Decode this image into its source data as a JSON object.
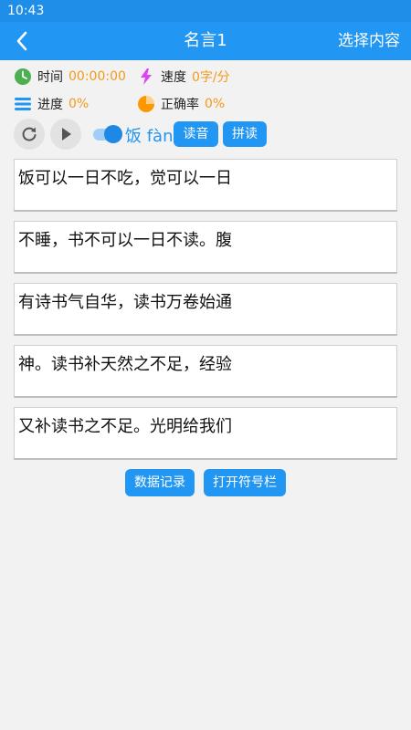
{
  "status_bar": {
    "time": "10:43"
  },
  "app_bar": {
    "title": "名言1",
    "action_label": "选择内容",
    "back_icon": "chevron-left-icon"
  },
  "stats": {
    "time_label": "时间",
    "time_value": "00:00:00",
    "speed_label": "速度",
    "speed_value": "0字/分",
    "progress_label": "进度",
    "progress_value": "0%",
    "accuracy_label": "正确率",
    "accuracy_value": "0%"
  },
  "controls": {
    "pinyin_toggle_on": true,
    "pinyin_label": "饭 fàn",
    "read_label": "读音",
    "spell_label": "拼读"
  },
  "text_lines": [
    "饭可以一日不吃，觉可以一日",
    "不睡，书不可以一日不读。腹",
    "有诗书气自华，读书万卷始通",
    "神。读书补天然之不足，经验",
    "又补读书之不足。光明给我们"
  ],
  "bottom_buttons": {
    "records_label": "数据记录",
    "symbols_label": "打开符号栏"
  },
  "colors": {
    "primary": "#2196f3",
    "accent": "#f39a1c",
    "clock_green": "#4caf50",
    "bolt_pink": "#e040fb",
    "pie_orange": "#ff9800"
  }
}
